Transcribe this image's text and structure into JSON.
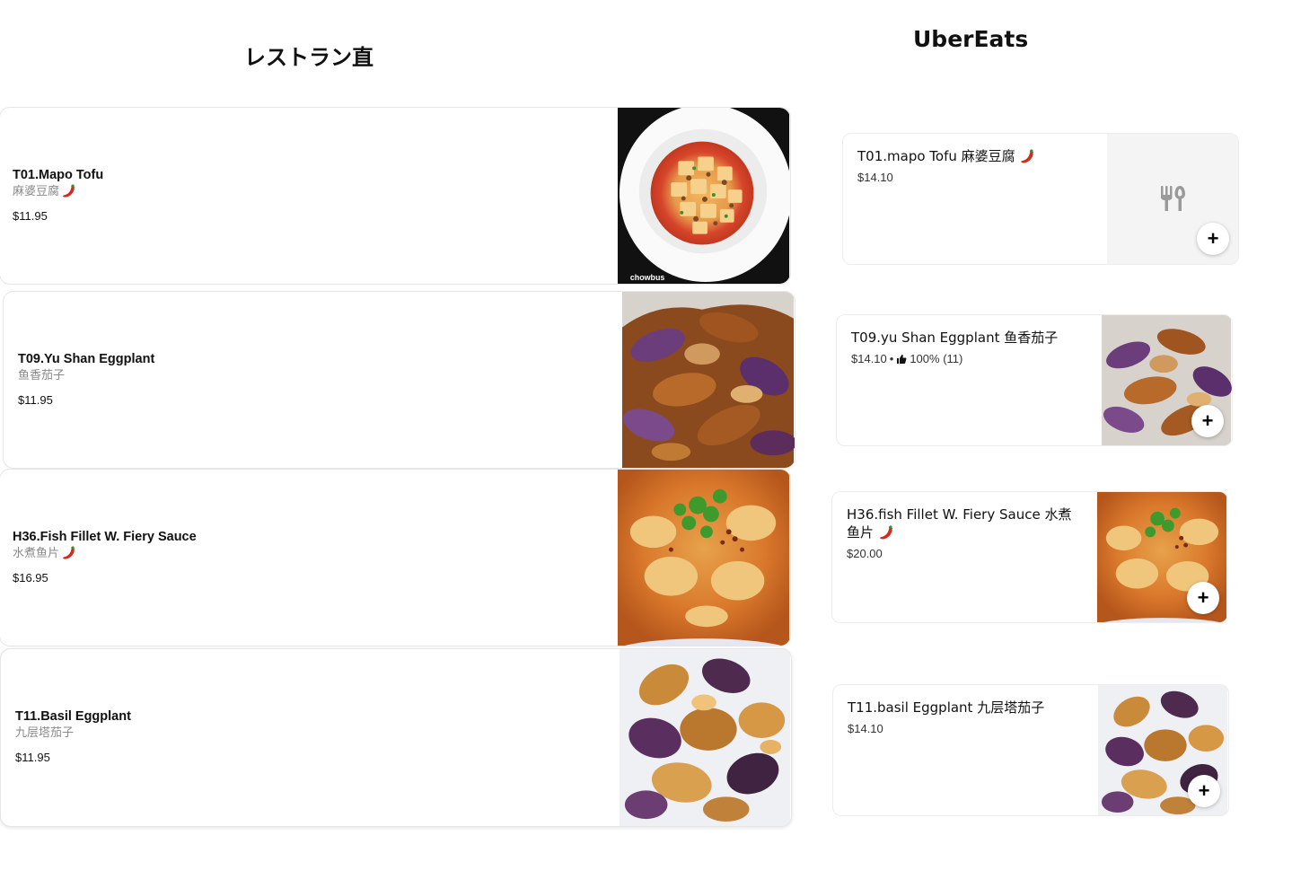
{
  "left": {
    "title": "レストラン直",
    "items": [
      {
        "name": "T01.Mapo Tofu",
        "sub": "麻婆豆腐",
        "price": "$11.95",
        "photo_watermark": "chowbus"
      },
      {
        "name": "T09.Yu Shan Eggplant",
        "sub": "鱼香茄子",
        "price": "$11.95"
      },
      {
        "name": "H36.Fish Fillet W. Fiery Sauce",
        "sub": "水煮鱼片",
        "price": "$16.95"
      },
      {
        "name": "T11.Basil Eggplant",
        "sub": "九层塔茄子",
        "price": "$11.95"
      }
    ]
  },
  "right": {
    "title": "UberEats",
    "items": [
      {
        "name": "T01.mapo Tofu 麻婆豆腐",
        "price": "$14.10",
        "rating": ""
      },
      {
        "name": "T09.yu Shan Eggplant 鱼香茄子",
        "price": "$14.10",
        "rating": "100% (11)"
      },
      {
        "name": "H36.fish Fillet W. Fiery Sauce 水煮鱼片",
        "price": "$20.00",
        "rating": ""
      },
      {
        "name": "T11.basil Eggplant 九层塔茄子",
        "price": "$14.10",
        "rating": ""
      }
    ],
    "add_label": "+"
  },
  "icons": {
    "spicy": "chili-pepper-icon",
    "placeholder": "fork-knife-icon",
    "rating": "thumbs-up-icon"
  },
  "colors": {
    "text": "#111111",
    "muted": "#8a8a8a",
    "chili": "#d42a1f"
  }
}
